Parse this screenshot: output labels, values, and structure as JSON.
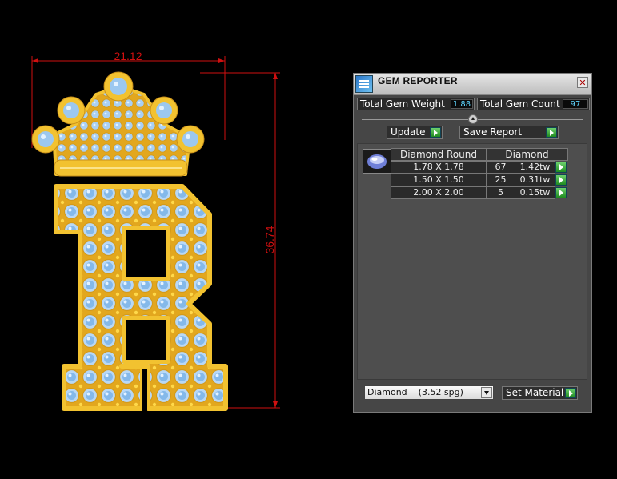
{
  "viewport": {
    "dimensions": {
      "width": "21.12",
      "height": "36.74"
    },
    "model_description_icon": "crowned-letter-b-pendant"
  },
  "panel": {
    "title": "GEM REPORTER",
    "close_icon": "close-icon",
    "stats": {
      "total_weight_label": "Total Gem Weight",
      "total_weight_value": "1.88",
      "total_count_label": "Total Gem Count",
      "total_count_value": "97"
    },
    "buttons": {
      "update_label": "Update",
      "save_report_label": "Save Report",
      "set_material_label": "Set Material"
    },
    "gem_table": {
      "header_shape": "Diamond Round",
      "header_material": "Diamond",
      "rows": [
        {
          "size": "1.78 X 1.78",
          "count": "67",
          "weight": "1.42tw"
        },
        {
          "size": "1.50 X 1.50",
          "count": "25",
          "weight": "0.31tw"
        },
        {
          "size": "2.00 X 2.00",
          "count": "5",
          "weight": "0.15tw"
        }
      ]
    },
    "material": {
      "selected": "Diamond    (3.52 spg)"
    }
  },
  "colors": {
    "dimension": "#d01010",
    "gold": "#f2c230",
    "gem": "#9cc8f0",
    "panel_bg": "#464646",
    "value_text": "#5fd6ff",
    "go_arrow": "#2fa02f"
  }
}
